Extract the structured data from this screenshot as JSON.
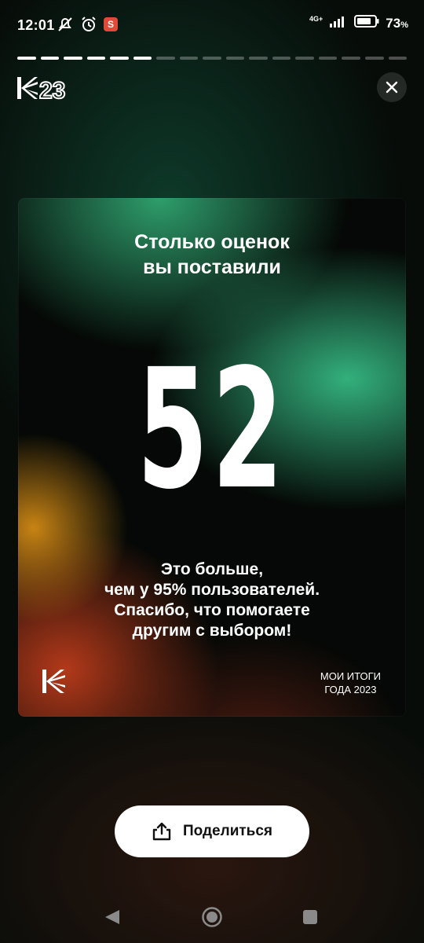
{
  "status_bar": {
    "time": "12:01",
    "network": "4G+",
    "battery": "73",
    "battery_unit": "%",
    "icons": [
      "mute-icon",
      "alarm-icon",
      "app-notification-icon",
      "signal-icon",
      "battery-icon"
    ]
  },
  "story_progress": {
    "total_segments": 17,
    "completed_segments": 6
  },
  "header": {
    "logo_text": "23",
    "close_icon": "close-icon"
  },
  "card": {
    "title_line1": "Столько оценок",
    "title_line2": "вы поставили",
    "number": "52",
    "desc_line1": "Это больше,",
    "desc_line2": "чем у 95% пользователей.",
    "desc_line3": "Спасибо, что помогаете",
    "desc_line4": "другим с выбором!",
    "caption_line1": "МОИ ИТОГИ",
    "caption_line2": "ГОДА 2023",
    "colors": {
      "green": "#33b07c",
      "orange": "#c98414",
      "red": "#b3391a",
      "dark": "#050806"
    }
  },
  "share": {
    "label": "Поделиться",
    "icon": "share-icon"
  },
  "nav": {
    "back": "back-icon",
    "home": "home-icon",
    "recents": "recents-icon"
  }
}
